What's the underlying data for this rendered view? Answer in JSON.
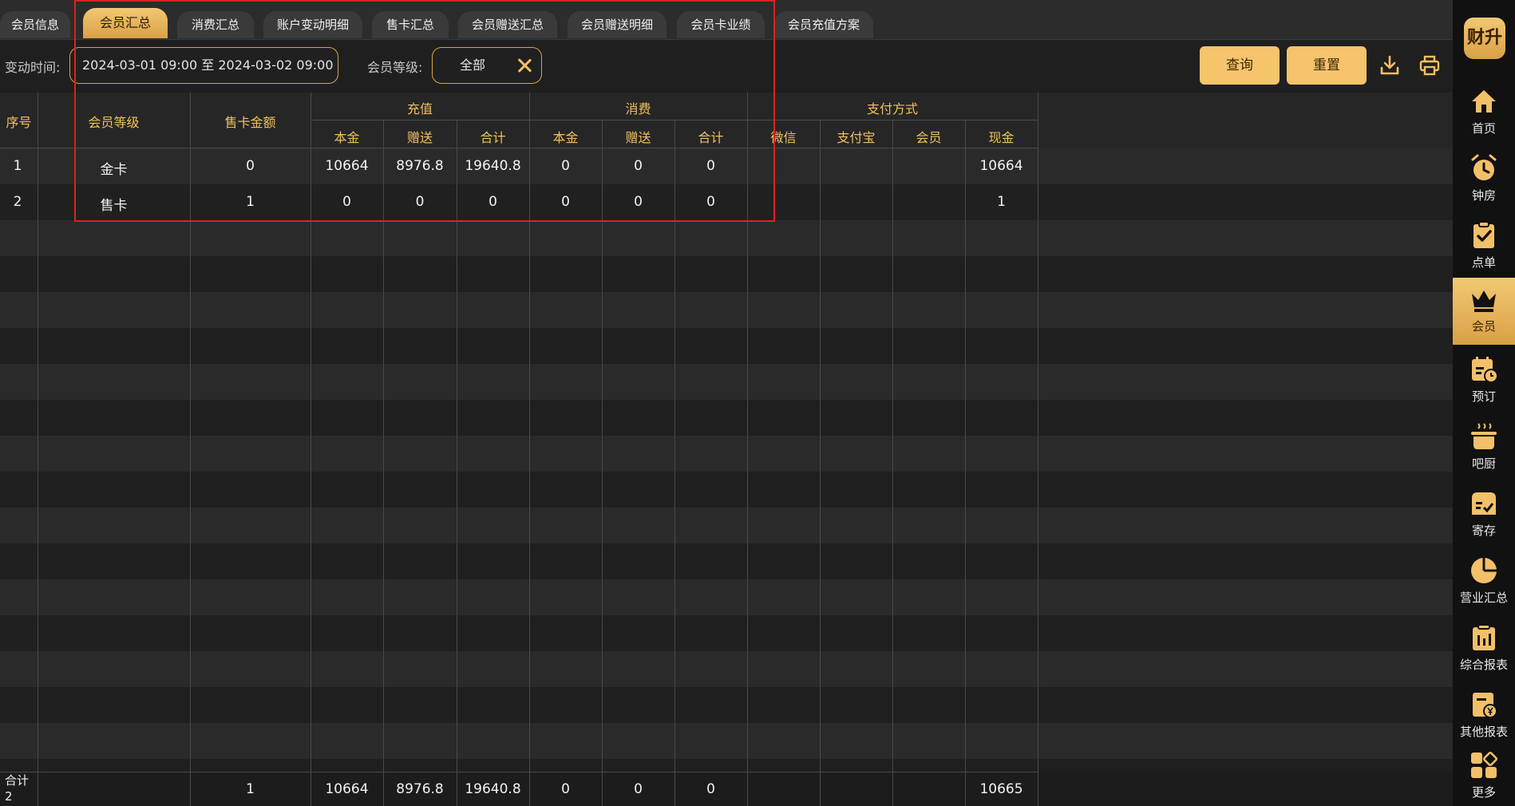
{
  "tabs": [
    "会员信息",
    "会员汇总",
    "消费汇总",
    "账户变动明细",
    "售卡汇总",
    "会员赠送汇总",
    "会员赠送明细",
    "会员卡业绩",
    "会员充值方案"
  ],
  "filters": {
    "time_label": "变动时间:",
    "time_value": "2024-03-01 09:00 至 2024-03-02 09:00",
    "level_label": "会员等级:",
    "level_value": "全部"
  },
  "buttons": {
    "query": "查询",
    "reset": "重置"
  },
  "table": {
    "headers": {
      "index": "序号",
      "level": "会员等级",
      "sale_amount": "售卡金额",
      "recharge": "充值",
      "consume": "消费",
      "payment": "支付方式",
      "principal": "本金",
      "gift": "赠送",
      "subtotal": "合计",
      "wechat": "微信",
      "alipay": "支付宝",
      "member": "会员",
      "cash": "现金"
    },
    "rows": [
      {
        "idx": "1",
        "level": "金卡",
        "sale": "0",
        "r_principal": "10664",
        "r_gift": "8976.8",
        "r_total": "19640.8",
        "c_principal": "0",
        "c_gift": "0",
        "c_total": "0",
        "wechat": "",
        "alipay": "",
        "member": "",
        "cash": "10664"
      },
      {
        "idx": "2",
        "level": "售卡",
        "sale": "1",
        "r_principal": "0",
        "r_gift": "0",
        "r_total": "0",
        "c_principal": "0",
        "c_gift": "0",
        "c_total": "0",
        "wechat": "",
        "alipay": "",
        "member": "",
        "cash": "1"
      }
    ],
    "footer": {
      "label": "合计",
      "count": "2",
      "sale": "1",
      "r_principal": "10664",
      "r_gift": "8976.8",
      "r_total": "19640.8",
      "c_principal": "0",
      "c_gift": "0",
      "c_total": "0",
      "cash": "10665"
    }
  },
  "sidebar": {
    "logo": "财升",
    "items": [
      {
        "label": "首页",
        "icon": "home-icon"
      },
      {
        "label": "钟房",
        "icon": "alarm-clock-icon"
      },
      {
        "label": "点单",
        "icon": "clipboard-check-icon"
      },
      {
        "label": "会员",
        "icon": "crown-icon"
      },
      {
        "label": "预订",
        "icon": "calendar-clock-icon"
      },
      {
        "label": "吧厨",
        "icon": "cooking-pot-icon"
      },
      {
        "label": "寄存",
        "icon": "storage-box-icon"
      },
      {
        "label": "营业汇总",
        "icon": "pie-chart-icon"
      },
      {
        "label": "综合报表",
        "icon": "report-bars-icon"
      },
      {
        "label": "其他报表",
        "icon": "yen-report-icon"
      },
      {
        "label": "更多",
        "icon": "grid-more-icon"
      }
    ],
    "active": "会员"
  },
  "colors": {
    "accent": "#f3c873",
    "highlight": "#e02020"
  }
}
